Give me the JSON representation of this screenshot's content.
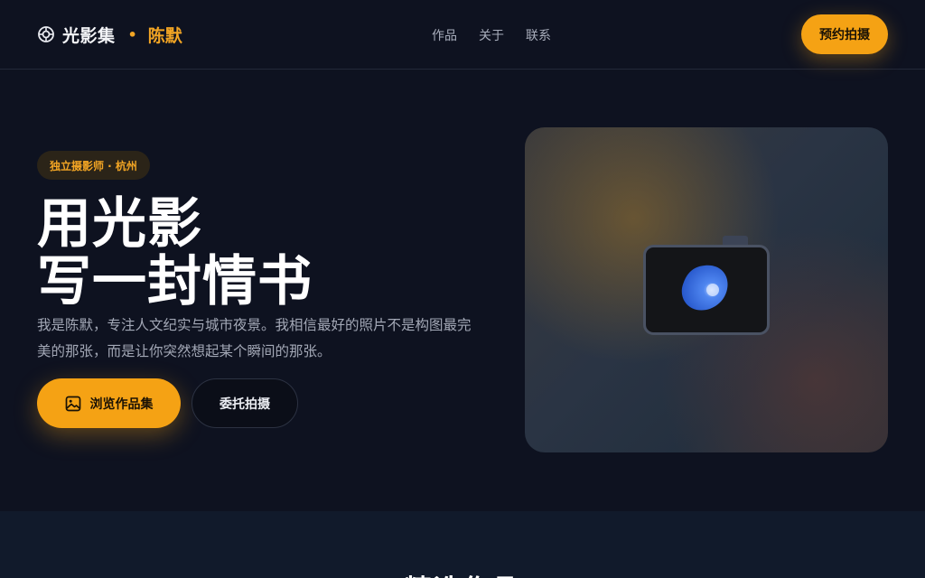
{
  "brand": {
    "name": "光影集",
    "separator": "•",
    "owner": "陈默",
    "icon": "aperture-icon"
  },
  "nav": {
    "items": [
      {
        "label": "作品"
      },
      {
        "label": "关于"
      },
      {
        "label": "联系"
      }
    ]
  },
  "header": {
    "cta_label": "预约拍摄"
  },
  "hero": {
    "badge": "独立摄影师 · 杭州",
    "title_line1": "用光影",
    "title_line2": "写一封情书",
    "description": "我是陈默，专注人文纪实与城市夜景。我相信最好的照片不是构图最完美的那张，而是让你突然想起某个瞬间的那张。",
    "primary_button": "浏览作品集",
    "primary_icon": "image-icon",
    "secondary_button": "委托拍摄"
  },
  "visual": {
    "icon": "camera-icon"
  },
  "section": {
    "title": "精选作品"
  },
  "colors": {
    "accent": "#f5a214",
    "background": "#0e1220",
    "section_background": "#111a2b"
  }
}
